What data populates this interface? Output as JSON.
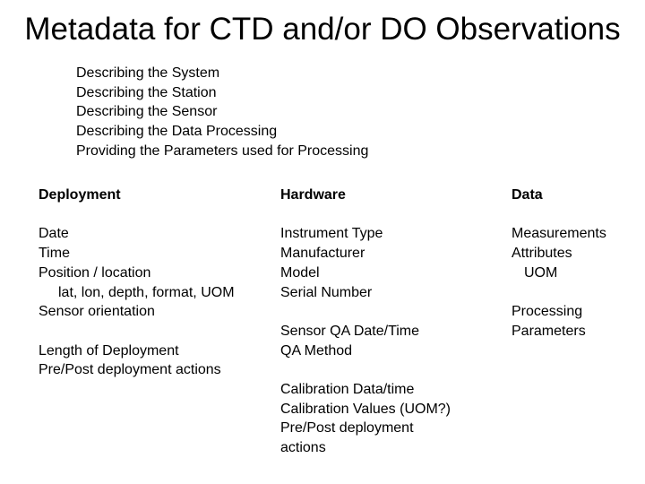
{
  "title": "Metadata for CTD and/or DO Observations",
  "bullets": [
    "Describing the System",
    "Describing the Station",
    "Describing the Sensor",
    "Describing the Data Processing",
    "Providing the Parameters used for Processing"
  ],
  "columns": {
    "deployment": {
      "heading": "Deployment",
      "items": [
        "Date",
        "Time",
        "Position / location",
        "lat, lon, depth, format, UOM",
        "Sensor orientation",
        "",
        "Length of Deployment",
        "Pre/Post deployment actions"
      ]
    },
    "hardware": {
      "heading": "Hardware",
      "items": [
        "Instrument Type",
        "Manufacturer",
        "Model",
        "Serial Number",
        "",
        "Sensor QA Date/Time",
        "QA Method",
        "",
        "Calibration Data/time",
        "Calibration Values (UOM?)",
        "Pre/Post deployment",
        "actions"
      ]
    },
    "data": {
      "heading": "Data",
      "items": [
        "Measurements",
        "Attributes",
        "UOM",
        "",
        "Processing",
        "Parameters"
      ]
    }
  }
}
